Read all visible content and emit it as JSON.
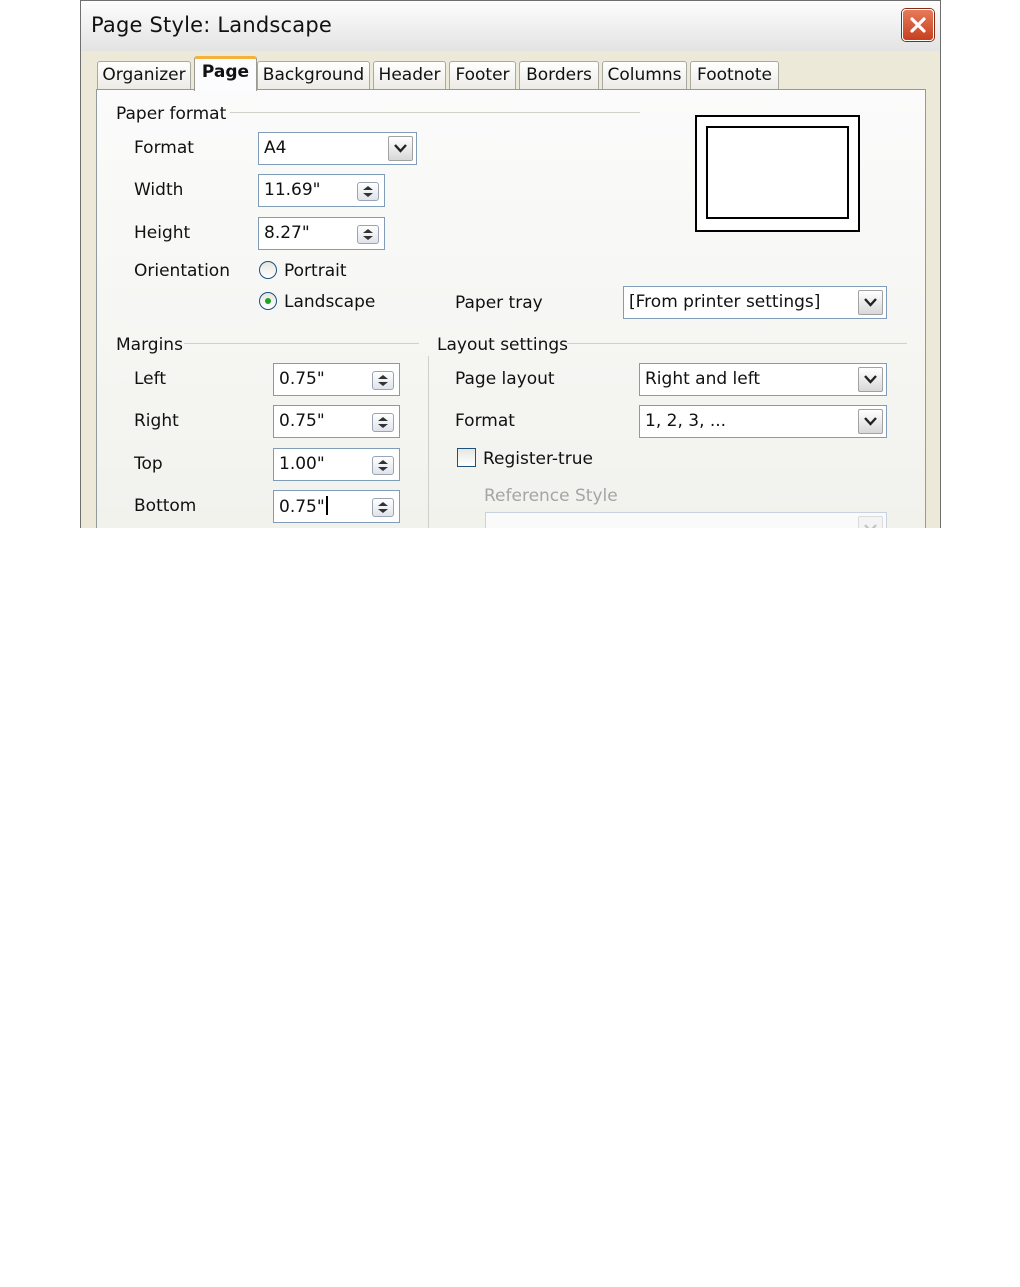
{
  "window": {
    "title": "Page Style: Landscape"
  },
  "tabs": [
    "Organizer",
    "Page",
    "Background",
    "Header",
    "Footer",
    "Borders",
    "Columns",
    "Footnote"
  ],
  "active_tab": "Page",
  "paper_format": {
    "section_label": "Paper format",
    "format_label": "Format",
    "format_value": "A4",
    "width_label": "Width",
    "width_value": "11.69\"",
    "height_label": "Height",
    "height_value": "8.27\"",
    "orientation_label": "Orientation",
    "portrait_label": "Portrait",
    "landscape_label": "Landscape",
    "orientation_selected": "Landscape",
    "paper_tray_label": "Paper tray",
    "paper_tray_value": "[From printer settings]"
  },
  "margins": {
    "section_label": "Margins",
    "left_label": "Left",
    "left_value": "0.75\"",
    "right_label": "Right",
    "right_value": "0.75\"",
    "top_label": "Top",
    "top_value": "1.00\"",
    "bottom_label": "Bottom",
    "bottom_value": "0.75\""
  },
  "layout_settings": {
    "section_label": "Layout settings",
    "page_layout_label": "Page layout",
    "page_layout_value": "Right and left",
    "format_label": "Format",
    "format_value": "1, 2, 3, ...",
    "register_true_label": "Register-true",
    "register_true_checked": false,
    "reference_style_label": "Reference Style",
    "reference_style_value": ""
  },
  "colors": {
    "accent_tab": "#f5b13d",
    "close_button": "#c5401f",
    "radio_dot": "#21a121"
  },
  "icons": [
    "close-icon",
    "spin-arrows-icon",
    "dropdown-arrow-icon",
    "radio-button",
    "checkbox"
  ]
}
